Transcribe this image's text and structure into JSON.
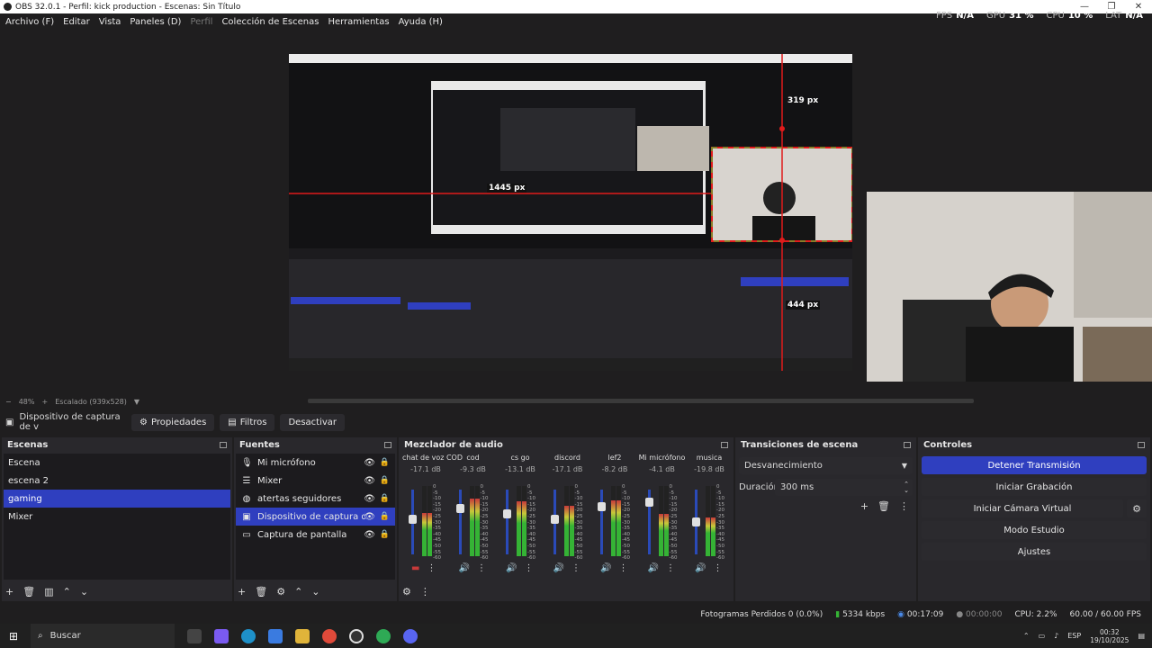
{
  "window": {
    "title": "OBS 32.0.1 - Perfil: kick production - Escenas: Sin Título",
    "controls": [
      "—",
      "❐",
      "✕"
    ]
  },
  "menu": [
    {
      "label": "Archivo (F)",
      "enabled": true
    },
    {
      "label": "Editar",
      "enabled": true
    },
    {
      "label": "Vista",
      "enabled": true
    },
    {
      "label": "Paneles (D)",
      "enabled": true
    },
    {
      "label": "Perfil",
      "enabled": false
    },
    {
      "label": "Colección de Escenas",
      "enabled": true
    },
    {
      "label": "Herramientas",
      "enabled": true
    },
    {
      "label": "Ayuda (H)",
      "enabled": true
    }
  ],
  "stats": {
    "fps_label": "FPS",
    "fps": "N/A",
    "gpu_label": "GPU",
    "gpu": "31 %",
    "cpu_label": "CPU",
    "cpu": "10 %",
    "lat_label": "LAT",
    "lat": "N/A"
  },
  "preview": {
    "measure_top": "319 px",
    "measure_left": "1445 px",
    "measure_bottom": "444 px"
  },
  "zoom": {
    "minus": "−",
    "level": "48%",
    "plus": "+",
    "scaling": "Escalado (939x528)"
  },
  "context_bar": {
    "source_name": "Dispositivo de captura de v",
    "properties": "Propiedades",
    "filters": "Filtros",
    "deactivate": "Desactivar"
  },
  "scenes": {
    "title": "Escenas",
    "items": [
      {
        "label": "Escena",
        "selected": false
      },
      {
        "label": "escena 2",
        "selected": false
      },
      {
        "label": "gaming",
        "selected": true
      },
      {
        "label": "Mixer",
        "selected": false
      }
    ]
  },
  "sources": {
    "title": "Fuentes",
    "items": [
      {
        "label": "Mi micrófono",
        "icon": "microphone-icon",
        "glyph": "🎙",
        "selected": false
      },
      {
        "label": "Mixer",
        "icon": "list-icon",
        "glyph": "☰",
        "selected": false
      },
      {
        "label": "atertas seguidores",
        "icon": "browser-icon",
        "glyph": "◍",
        "selected": false
      },
      {
        "label": "Dispositivo de captura de vide",
        "icon": "camera-icon",
        "glyph": "▣",
        "selected": true
      },
      {
        "label": "Captura de pantalla",
        "icon": "monitor-icon",
        "glyph": "▭",
        "selected": false
      }
    ]
  },
  "mixer": {
    "title": "Mezclador de audio",
    "scale": [
      "0",
      "-5",
      "-10",
      "-15",
      "-20",
      "-25",
      "-30",
      "-35",
      "-40",
      "-45",
      "-50",
      "-55",
      "-60"
    ],
    "channels": [
      {
        "name": "chat de voz COD",
        "db": "-17.1 dB",
        "fader": 0.55,
        "level": 0.62,
        "muted": true
      },
      {
        "name": "cod",
        "db": "-9.3 dB",
        "fader": 0.75,
        "level": 0.82,
        "muted": false
      },
      {
        "name": "cs go",
        "db": "-13.1 dB",
        "fader": 0.65,
        "level": 0.78,
        "muted": false
      },
      {
        "name": "discord",
        "db": "-17.1 dB",
        "fader": 0.55,
        "level": 0.72,
        "muted": false
      },
      {
        "name": "lef2",
        "db": "-8.2 dB",
        "fader": 0.78,
        "level": 0.8,
        "muted": false
      },
      {
        "name": "Mi micrófono",
        "db": "-4.1 dB",
        "fader": 0.86,
        "level": 0.6,
        "muted": false
      },
      {
        "name": "musica",
        "db": "-19.8 dB",
        "fader": 0.5,
        "level": 0.55,
        "muted": false
      }
    ]
  },
  "transitions": {
    "title": "Transiciones de escena",
    "selected": "Desvanecimiento",
    "duration_label": "Duración",
    "duration": "300 ms"
  },
  "controls": {
    "title": "Controles",
    "stop_stream": "Detener Transmisión",
    "start_recording": "Iniciar Grabación",
    "virtual_cam": "Iniciar Cámara Virtual",
    "studio_mode": "Modo Estudio",
    "settings": "Ajustes"
  },
  "status": {
    "dropped": "Fotogramas Perdidos 0 (0.0%)",
    "bitrate": "5334 kbps",
    "stream_time": "00:17:09",
    "rec_time": "00:00:00",
    "cpu": "CPU: 2.2%",
    "fps": "60.00 / 60.00 FPS"
  },
  "taskbar": {
    "search": "Buscar",
    "lang": "ESP",
    "time": "00:32",
    "date": "19/10/2025"
  },
  "colors": {
    "accent": "#2f3fbf",
    "guide": "#e01b1b",
    "bg": "#1f1e1f"
  }
}
